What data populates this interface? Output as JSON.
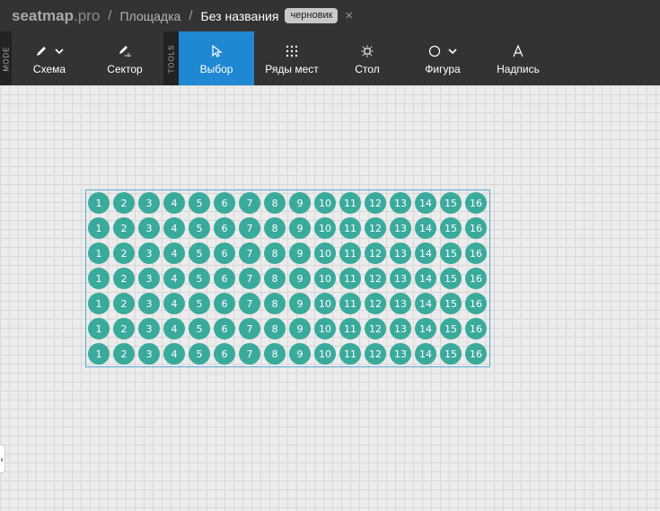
{
  "header": {
    "logo_name": "seatmap",
    "logo_ext": ".pro",
    "sep1": "/",
    "crumb_venue": "Площадка",
    "sep2": "/",
    "crumb_current": "Без названия",
    "badge": "черновик",
    "close": "×"
  },
  "toolbar": {
    "mode_label": "MODE",
    "tools_label": "TOOLS",
    "mode_items": [
      {
        "label": "Схема",
        "icon": "pencil-icon",
        "has_dropdown": true
      },
      {
        "label": "Сектор",
        "icon": "pencil-sector-icon",
        "has_dropdown": false
      }
    ],
    "tool_items": [
      {
        "label": "Выбор",
        "icon": "cursor-icon",
        "active": true
      },
      {
        "label": "Ряды мест",
        "icon": "dot-grid-icon",
        "active": false
      },
      {
        "label": "Стол",
        "icon": "table-icon",
        "active": false
      },
      {
        "label": "Фигура",
        "icon": "circle-icon",
        "active": false,
        "has_dropdown": true
      },
      {
        "label": "Надпись",
        "icon": "text-icon",
        "active": false
      }
    ]
  },
  "canvas": {
    "seat_color": "#3aaa9c",
    "selection_color": "#5aa9d8",
    "rows": [
      [
        "1",
        "2",
        "3",
        "4",
        "5",
        "6",
        "7",
        "8",
        "9",
        "10",
        "11",
        "12",
        "13",
        "14",
        "15",
        "16"
      ],
      [
        "1",
        "2",
        "3",
        "4",
        "5",
        "6",
        "7",
        "8",
        "9",
        "10",
        "11",
        "12",
        "13",
        "14",
        "15",
        "16"
      ],
      [
        "1",
        "2",
        "3",
        "4",
        "5",
        "6",
        "7",
        "8",
        "9",
        "10",
        "11",
        "12",
        "13",
        "14",
        "15",
        "16"
      ],
      [
        "1",
        "2",
        "3",
        "4",
        "5",
        "6",
        "7",
        "8",
        "9",
        "10",
        "11",
        "12",
        "13",
        "14",
        "15",
        "16"
      ],
      [
        "1",
        "2",
        "3",
        "4",
        "5",
        "6",
        "7",
        "8",
        "9",
        "10",
        "11",
        "12",
        "13",
        "14",
        "15",
        "16"
      ],
      [
        "1",
        "2",
        "3",
        "4",
        "5",
        "6",
        "7",
        "8",
        "9",
        "10",
        "11",
        "12",
        "13",
        "14",
        "15",
        "16"
      ],
      [
        "1",
        "2",
        "3",
        "4",
        "5",
        "6",
        "7",
        "8",
        "9",
        "10",
        "11",
        "12",
        "13",
        "14",
        "15",
        "16"
      ]
    ]
  }
}
